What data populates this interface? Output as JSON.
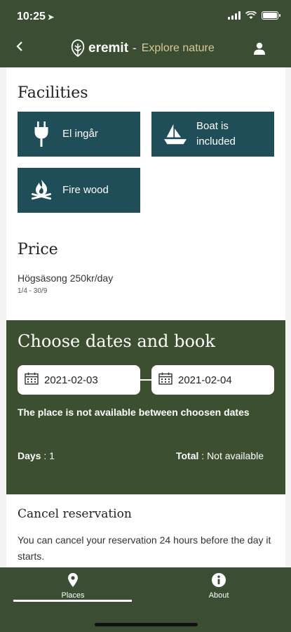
{
  "status_bar": {
    "time": "10:25"
  },
  "header": {
    "brand": "eremit",
    "separator": "-",
    "subtitle": "Explore nature"
  },
  "facilities": {
    "title": "Facilities",
    "items": [
      {
        "label": "El ingår",
        "icon": "plug-icon"
      },
      {
        "label": "Boat is included",
        "icon": "boat-icon"
      },
      {
        "label": "Fire wood",
        "icon": "campfire-icon"
      }
    ]
  },
  "price": {
    "title": "Price",
    "line": "Högsäsong 250kr/day",
    "dates": "1/4 - 30/9"
  },
  "booking": {
    "title": "Choose dates and book",
    "start_date": "2021-02-03",
    "end_date": "2021-02-04",
    "availability_message": "The place is not available between choosen dates",
    "days_label": "Days",
    "days_value": "1",
    "total_label": "Total",
    "total_value": "Not available"
  },
  "cancel": {
    "title": "Cancel reservation",
    "text": "You can cancel your reservation 24 hours before the day it starts."
  },
  "tabs": [
    {
      "label": "Places",
      "icon": "location-pin-icon",
      "active": true
    },
    {
      "label": "About",
      "icon": "info-icon",
      "active": false
    }
  ],
  "colors": {
    "header": "#3b4d33",
    "facility_tile": "#1f4d58",
    "booking_panel": "#3d4f31",
    "accent": "#d8c898"
  }
}
